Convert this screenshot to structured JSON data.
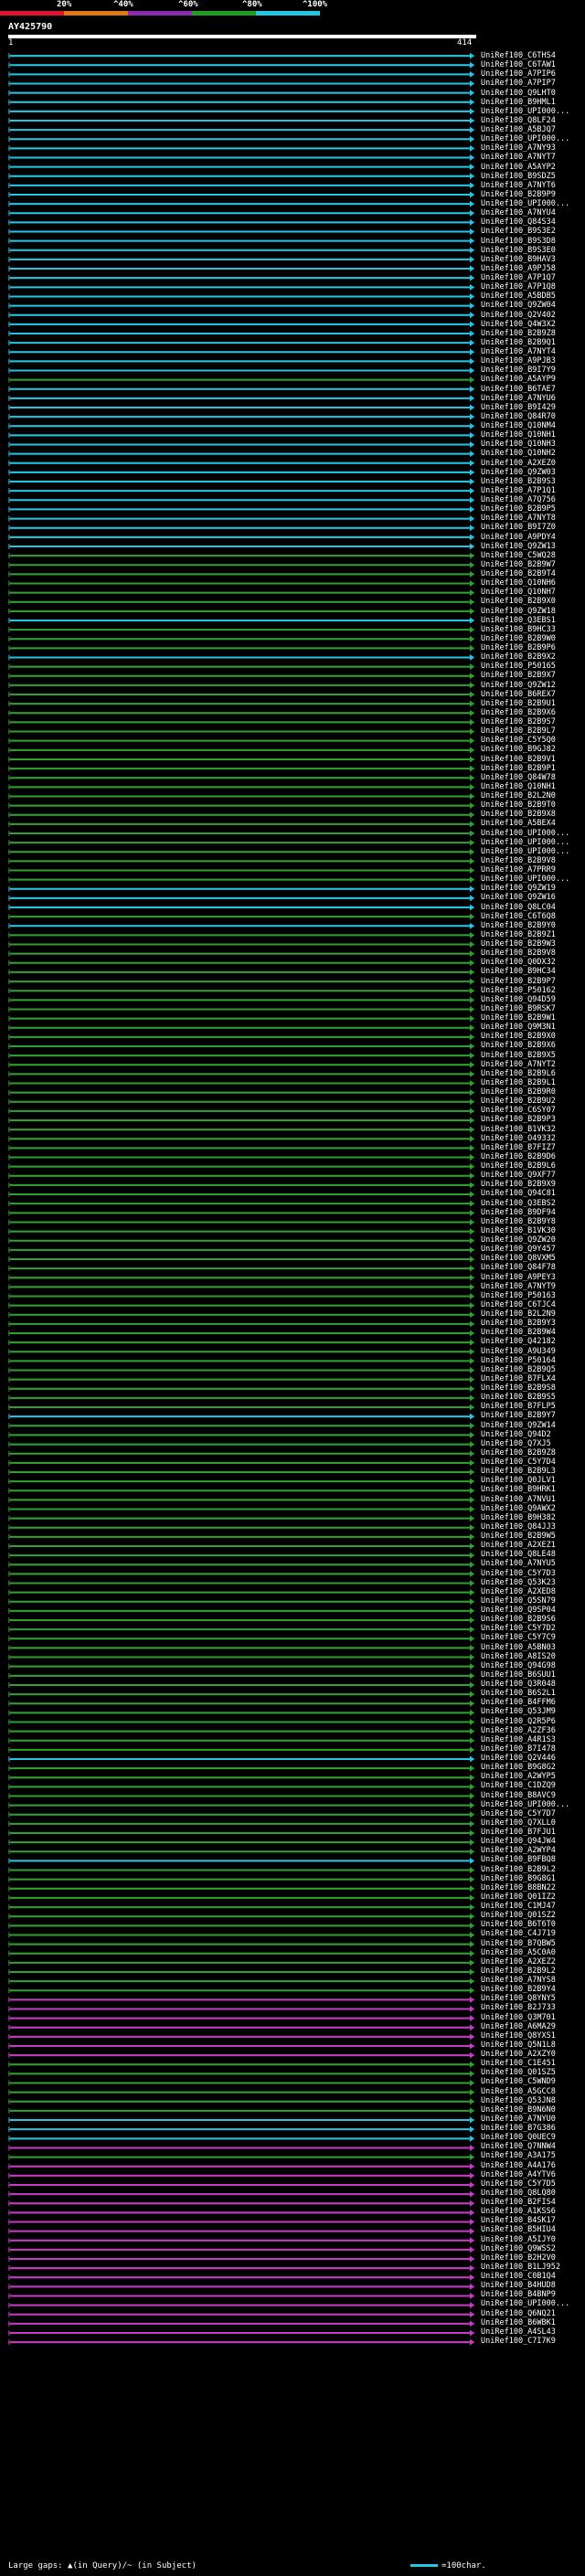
{
  "header": {
    "scale_ticks": [
      "20%",
      "^40%",
      "^60%",
      "^80%",
      "^100%"
    ],
    "scale_colors": [
      "#e0142c",
      "#e07a10",
      "#8a2bb0",
      "#1e9d1e",
      "#22c7e6"
    ],
    "query_name": "AY425790",
    "query_start": "1",
    "query_end": "414"
  },
  "footer": {
    "gap_note": "Large gaps: ▲(in Query)/~ (in Subject)",
    "scale_note": "=100char."
  },
  "colors": {
    "cyan": "#22c7e6",
    "green": "#2fa12f",
    "magenta": "#c93ac9",
    "gap": "#333333"
  },
  "hits": [
    {
      "id": "UniRef100_C6THS4",
      "color": "cyan"
    },
    {
      "id": "UniRef100_C6TAW1",
      "color": "cyan"
    },
    {
      "id": "UniRef100_A7PIP6",
      "color": "cyan"
    },
    {
      "id": "UniRef100_A7PIP7",
      "color": "cyan"
    },
    {
      "id": "UniRef100_Q9LHT0",
      "color": "cyan"
    },
    {
      "id": "UniRef100_B9HML1",
      "color": "cyan"
    },
    {
      "id": "UniRef100_UPI000...",
      "color": "cyan"
    },
    {
      "id": "UniRef100_Q8LF24",
      "color": "cyan"
    },
    {
      "id": "UniRef100_A5BJQ7",
      "color": "cyan"
    },
    {
      "id": "UniRef100_UPI000...",
      "color": "cyan"
    },
    {
      "id": "UniRef100_A7NY93",
      "color": "cyan"
    },
    {
      "id": "UniRef100_A7NYT7",
      "color": "cyan"
    },
    {
      "id": "UniRef100_A5AYP2",
      "color": "cyan"
    },
    {
      "id": "UniRef100_B9SDZ5",
      "color": "cyan"
    },
    {
      "id": "UniRef100_A7NYT6",
      "color": "cyan"
    },
    {
      "id": "UniRef100_B2B9P9",
      "color": "cyan"
    },
    {
      "id": "UniRef100_UPI000...",
      "color": "cyan"
    },
    {
      "id": "UniRef100_A7NYU4",
      "color": "cyan"
    },
    {
      "id": "UniRef100_Q84S34",
      "color": "cyan"
    },
    {
      "id": "UniRef100_B9S3E2",
      "color": "cyan"
    },
    {
      "id": "UniRef100_B9S3D8",
      "color": "cyan"
    },
    {
      "id": "UniRef100_B9S3E0",
      "color": "cyan"
    },
    {
      "id": "UniRef100_B9HAV3",
      "color": "cyan"
    },
    {
      "id": "UniRef100_A9PJ58",
      "color": "cyan"
    },
    {
      "id": "UniRef100_A7P1Q7",
      "color": "cyan"
    },
    {
      "id": "UniRef100_A7P1Q8",
      "color": "cyan"
    },
    {
      "id": "UniRef100_A5BDB5",
      "color": "cyan"
    },
    {
      "id": "UniRef100_Q9ZW04",
      "color": "cyan"
    },
    {
      "id": "UniRef100_Q2V402",
      "color": "cyan"
    },
    {
      "id": "UniRef100_Q4W3X2",
      "color": "cyan"
    },
    {
      "id": "UniRef100_B2B9Z8",
      "color": "cyan"
    },
    {
      "id": "UniRef100_B2B9Q1",
      "color": "cyan"
    },
    {
      "id": "UniRef100_A7NYT4",
      "color": "cyan"
    },
    {
      "id": "UniRef100_A9PJB3",
      "color": "cyan"
    },
    {
      "id": "UniRef100_B9I7Y9",
      "color": "cyan"
    },
    {
      "id": "UniRef100_A5AYP9",
      "color": "green"
    },
    {
      "id": "UniRef100_B6TAE7",
      "color": "cyan"
    },
    {
      "id": "UniRef100_A7NYU6",
      "color": "cyan"
    },
    {
      "id": "UniRef100_B9I429",
      "color": "cyan"
    },
    {
      "id": "UniRef100_Q84R70",
      "color": "cyan"
    },
    {
      "id": "UniRef100_Q10NM4",
      "color": "cyan"
    },
    {
      "id": "UniRef100_Q10NH1",
      "color": "cyan"
    },
    {
      "id": "UniRef100_Q10NH3",
      "color": "cyan"
    },
    {
      "id": "UniRef100_Q10NH2",
      "color": "cyan"
    },
    {
      "id": "UniRef100_A2XEZ0",
      "color": "cyan"
    },
    {
      "id": "UniRef100_Q9ZW03",
      "color": "cyan"
    },
    {
      "id": "UniRef100_B2B9S3",
      "color": "cyan"
    },
    {
      "id": "UniRef100_A7P1Q1",
      "color": "cyan"
    },
    {
      "id": "UniRef100_A7Q756",
      "color": "cyan"
    },
    {
      "id": "UniRef100_B2B9P5",
      "color": "cyan"
    },
    {
      "id": "UniRef100_A7NYT8",
      "color": "cyan"
    },
    {
      "id": "UniRef100_B9I7Z0",
      "color": "cyan"
    },
    {
      "id": "UniRef100_A9PDY4",
      "color": "cyan"
    },
    {
      "id": "UniRef100_Q9ZW13",
      "color": "cyan"
    },
    {
      "id": "UniRef100_C5WQ28",
      "color": "green"
    },
    {
      "id": "UniRef100_B2B9W7",
      "color": "green"
    },
    {
      "id": "UniRef100_B2B9T4",
      "color": "green"
    },
    {
      "id": "UniRef100_Q10NH6",
      "color": "green"
    },
    {
      "id": "UniRef100_Q10NH7",
      "color": "green"
    },
    {
      "id": "UniRef100_B2B9X0",
      "color": "green"
    },
    {
      "id": "UniRef100_Q9ZW18",
      "color": "green"
    },
    {
      "id": "UniRef100_Q3EBS1",
      "color": "cyan"
    },
    {
      "id": "UniRef100_B9HC33",
      "color": "green"
    },
    {
      "id": "UniRef100_B2B9W0",
      "color": "green"
    },
    {
      "id": "UniRef100_B2B9P6",
      "color": "green"
    },
    {
      "id": "UniRef100_B2B9X2",
      "color": "cyan"
    },
    {
      "id": "UniRef100_P50165",
      "color": "green"
    },
    {
      "id": "UniRef100_B2B9X7",
      "color": "green"
    },
    {
      "id": "UniRef100_Q9ZW12",
      "color": "green"
    },
    {
      "id": "UniRef100_B6REX7",
      "color": "green"
    },
    {
      "id": "UniRef100_B2B9U1",
      "color": "green"
    },
    {
      "id": "UniRef100_B2B9X6",
      "color": "green"
    },
    {
      "id": "UniRef100_B2B9S7",
      "color": "green"
    },
    {
      "id": "UniRef100_B2B9L7",
      "color": "green"
    },
    {
      "id": "UniRef100_C5Y5Q0",
      "color": "green"
    },
    {
      "id": "UniRef100_B9GJ82",
      "color": "green"
    },
    {
      "id": "UniRef100_B2B9V1",
      "color": "green"
    },
    {
      "id": "UniRef100_B2B9P1",
      "color": "green"
    },
    {
      "id": "UniRef100_Q84W78",
      "color": "green"
    },
    {
      "id": "UniRef100_Q10NH1",
      "color": "green"
    },
    {
      "id": "UniRef100_B2L2N0",
      "color": "green"
    },
    {
      "id": "UniRef100_B2B9T0",
      "color": "green"
    },
    {
      "id": "UniRef100_B2B9X8",
      "color": "green"
    },
    {
      "id": "UniRef100_A5BEX4",
      "color": "green"
    },
    {
      "id": "UniRef100_UPI000...",
      "color": "green"
    },
    {
      "id": "UniRef100_UPI000...",
      "color": "green"
    },
    {
      "id": "UniRef100_UPI000...",
      "color": "green"
    },
    {
      "id": "UniRef100_B2B9V8",
      "color": "green"
    },
    {
      "id": "UniRef100_A7PRR9",
      "color": "green"
    },
    {
      "id": "UniRef100_UPI000...",
      "color": "green"
    },
    {
      "id": "UniRef100_Q9ZW19",
      "color": "cyan"
    },
    {
      "id": "UniRef100_Q9ZW16",
      "color": "cyan"
    },
    {
      "id": "UniRef100_Q8LC04",
      "color": "cyan"
    },
    {
      "id": "UniRef100_C6T6Q8",
      "color": "green"
    },
    {
      "id": "UniRef100_B2B9Y0",
      "color": "cyan"
    },
    {
      "id": "UniRef100_B2B9Z1",
      "color": "green"
    },
    {
      "id": "UniRef100_B2B9W3",
      "color": "green"
    },
    {
      "id": "UniRef100_B2B9V8",
      "color": "green"
    },
    {
      "id": "UniRef100_Q0DX32",
      "color": "green"
    },
    {
      "id": "UniRef100_B9HC34",
      "color": "green"
    },
    {
      "id": "UniRef100_B2B9P7",
      "color": "green"
    },
    {
      "id": "UniRef100_P50162",
      "color": "green"
    },
    {
      "id": "UniRef100_Q94D59",
      "color": "green"
    },
    {
      "id": "UniRef100_B9RSK7",
      "color": "green"
    },
    {
      "id": "UniRef100_B2B9W1",
      "color": "green"
    },
    {
      "id": "UniRef100_Q9M3N1",
      "color": "green"
    },
    {
      "id": "UniRef100_B2B9X0",
      "color": "green"
    },
    {
      "id": "UniRef100_B2B9X6",
      "color": "green"
    },
    {
      "id": "UniRef100_B2B9X5",
      "color": "green"
    },
    {
      "id": "UniRef100_A7NYT2",
      "color": "green"
    },
    {
      "id": "UniRef100_B2B9L6",
      "color": "green"
    },
    {
      "id": "UniRef100_B2B9L1",
      "color": "green"
    },
    {
      "id": "UniRef100_B2B9R0",
      "color": "green"
    },
    {
      "id": "UniRef100_B2B9U2",
      "color": "green"
    },
    {
      "id": "UniRef100_C6SY07",
      "color": "green"
    },
    {
      "id": "UniRef100_B2B9P3",
      "color": "green"
    },
    {
      "id": "UniRef100_B1VK32",
      "color": "green"
    },
    {
      "id": "UniRef100_O49332",
      "color": "green"
    },
    {
      "id": "UniRef100_B7FIZ7",
      "color": "green"
    },
    {
      "id": "UniRef100_B2B9D6",
      "color": "green"
    },
    {
      "id": "UniRef100_B2B9L6",
      "color": "green"
    },
    {
      "id": "UniRef100_Q9XF77",
      "color": "green"
    },
    {
      "id": "UniRef100_B2B9X9",
      "color": "green"
    },
    {
      "id": "UniRef100_Q94C81",
      "color": "green"
    },
    {
      "id": "UniRef100_Q3EBS2",
      "color": "green"
    },
    {
      "id": "UniRef100_B9DF94",
      "color": "green"
    },
    {
      "id": "UniRef100_B2B9Y8",
      "color": "green"
    },
    {
      "id": "UniRef100_B1VK30",
      "color": "green"
    },
    {
      "id": "UniRef100_Q9ZW20",
      "color": "green"
    },
    {
      "id": "UniRef100_Q9Y457",
      "color": "green"
    },
    {
      "id": "UniRef100_Q8VXM5",
      "color": "green"
    },
    {
      "id": "UniRef100_Q84F78",
      "color": "green"
    },
    {
      "id": "UniRef100_A9PEY3",
      "color": "green"
    },
    {
      "id": "UniRef100_A7NYT9",
      "color": "green"
    },
    {
      "id": "UniRef100_P50163",
      "color": "green"
    },
    {
      "id": "UniRef100_C6TJC4",
      "color": "green"
    },
    {
      "id": "UniRef100_B2L2N9",
      "color": "green"
    },
    {
      "id": "UniRef100_B2B9Y3",
      "color": "green"
    },
    {
      "id": "UniRef100_B2B9W4",
      "color": "green"
    },
    {
      "id": "UniRef100_Q42182",
      "color": "green"
    },
    {
      "id": "UniRef100_A9U349",
      "color": "green"
    },
    {
      "id": "UniRef100_P50164",
      "color": "green"
    },
    {
      "id": "UniRef100_B2B9Q5",
      "color": "green"
    },
    {
      "id": "UniRef100_B7FLX4",
      "color": "green"
    },
    {
      "id": "UniRef100_B2B9S8",
      "color": "green"
    },
    {
      "id": "UniRef100_B2B9S5",
      "color": "green"
    },
    {
      "id": "UniRef100_B7FLP5",
      "color": "green"
    },
    {
      "id": "UniRef100_B2B9Y7",
      "color": "cyan"
    },
    {
      "id": "UniRef100_Q9ZW14",
      "color": "green"
    },
    {
      "id": "UniRef100_Q94D2",
      "color": "green"
    },
    {
      "id": "UniRef100_Q7XJ5",
      "color": "green"
    },
    {
      "id": "UniRef100_B2B9Z8",
      "color": "green"
    },
    {
      "id": "UniRef100_C5Y7D4",
      "color": "green"
    },
    {
      "id": "UniRef100_B2B9L3",
      "color": "green"
    },
    {
      "id": "UniRef100_Q0JLV1",
      "color": "green"
    },
    {
      "id": "UniRef100_B9HRK1",
      "color": "green"
    },
    {
      "id": "UniRef100_A7NVU1",
      "color": "green"
    },
    {
      "id": "UniRef100_Q9AWX2",
      "color": "green"
    },
    {
      "id": "UniRef100_B9H382",
      "color": "green"
    },
    {
      "id": "UniRef100_Q84JJ3",
      "color": "green"
    },
    {
      "id": "UniRef100_B2B9W5",
      "color": "green"
    },
    {
      "id": "UniRef100_A2XEZ1",
      "color": "green"
    },
    {
      "id": "UniRef100_Q8LE48",
      "color": "green"
    },
    {
      "id": "UniRef100_A7NYU5",
      "color": "green"
    },
    {
      "id": "UniRef100_C5Y7D3",
      "color": "green"
    },
    {
      "id": "UniRef100_Q53K23",
      "color": "green"
    },
    {
      "id": "UniRef100_A2XED8",
      "color": "green"
    },
    {
      "id": "UniRef100_Q5SN79",
      "color": "green"
    },
    {
      "id": "UniRef100_Q9SP04",
      "color": "green"
    },
    {
      "id": "UniRef100_B2B9S6",
      "color": "green"
    },
    {
      "id": "UniRef100_C5Y7D2",
      "color": "green"
    },
    {
      "id": "UniRef100_C5Y7C9",
      "color": "green"
    },
    {
      "id": "UniRef100_A5BN03",
      "color": "green"
    },
    {
      "id": "UniRef100_A8IS20",
      "color": "green"
    },
    {
      "id": "UniRef100_Q94G98",
      "color": "green"
    },
    {
      "id": "UniRef100_B6SUU1",
      "color": "green"
    },
    {
      "id": "UniRef100_Q3R048",
      "color": "green"
    },
    {
      "id": "UniRef100_B6S2L1",
      "color": "green"
    },
    {
      "id": "UniRef100_B4FFM6",
      "color": "green"
    },
    {
      "id": "UniRef100_Q53JM9",
      "color": "green"
    },
    {
      "id": "UniRef100_Q2R5P6",
      "color": "green"
    },
    {
      "id": "UniRef100_A2ZF36",
      "color": "green"
    },
    {
      "id": "UniRef100_A4R1S3",
      "color": "green"
    },
    {
      "id": "UniRef100_B7I478",
      "color": "green"
    },
    {
      "id": "UniRef100_Q2V446",
      "color": "cyan"
    },
    {
      "id": "UniRef100_B9G8G2",
      "color": "green"
    },
    {
      "id": "UniRef100_A2WYP5",
      "color": "green"
    },
    {
      "id": "UniRef100_C1DZQ9",
      "color": "green"
    },
    {
      "id": "UniRef100_B8AVC9",
      "color": "green"
    },
    {
      "id": "UniRef100_UPI000...",
      "color": "green"
    },
    {
      "id": "UniRef100_C5Y7D7",
      "color": "green"
    },
    {
      "id": "UniRef100_Q7XLL0",
      "color": "green"
    },
    {
      "id": "UniRef100_B7FJU1",
      "color": "green"
    },
    {
      "id": "UniRef100_Q94JW4",
      "color": "green"
    },
    {
      "id": "UniRef100_A2WYP4",
      "color": "green"
    },
    {
      "id": "UniRef100_B9FBQ8",
      "color": "cyan"
    },
    {
      "id": "UniRef100_B2B9L2",
      "color": "green"
    },
    {
      "id": "UniRef100_B9G8G1",
      "color": "green"
    },
    {
      "id": "UniRef100_B8BN22",
      "color": "green"
    },
    {
      "id": "UniRef100_Q01IZ2",
      "color": "green"
    },
    {
      "id": "UniRef100_C1MJ47",
      "color": "green"
    },
    {
      "id": "UniRef100_Q01SZ2",
      "color": "green"
    },
    {
      "id": "UniRef100_B6T6T0",
      "color": "green"
    },
    {
      "id": "UniRef100_C4J719",
      "color": "green"
    },
    {
      "id": "UniRef100_B7QBW5",
      "color": "green"
    },
    {
      "id": "UniRef100_A5C0A0",
      "color": "green"
    },
    {
      "id": "UniRef100_A2XEZ2",
      "color": "green"
    },
    {
      "id": "UniRef100_B2B9L2",
      "color": "green"
    },
    {
      "id": "UniRef100_A7NYS8",
      "color": "green"
    },
    {
      "id": "UniRef100_B2B9Y4",
      "color": "green"
    },
    {
      "id": "UniRef100_Q8YNY5",
      "color": "magenta"
    },
    {
      "id": "UniRef100_B2J733",
      "color": "magenta"
    },
    {
      "id": "UniRef100_Q3M701",
      "color": "magenta"
    },
    {
      "id": "UniRef100_A6MA29",
      "color": "magenta"
    },
    {
      "id": "UniRef100_Q8YXS1",
      "color": "magenta"
    },
    {
      "id": "UniRef100_Q5N1L8",
      "color": "magenta"
    },
    {
      "id": "UniRef100_A2XZY0",
      "color": "magenta"
    },
    {
      "id": "UniRef100_C1E451",
      "color": "green"
    },
    {
      "id": "UniRef100_Q01SZ5",
      "color": "green"
    },
    {
      "id": "UniRef100_C5WND9",
      "color": "green"
    },
    {
      "id": "UniRef100_A5GCC8",
      "color": "green"
    },
    {
      "id": "UniRef100_Q53JN8",
      "color": "green"
    },
    {
      "id": "UniRef100_B9N6N0",
      "color": "green"
    },
    {
      "id": "UniRef100_A7NYU0",
      "color": "cyan"
    },
    {
      "id": "UniRef100_B7G386",
      "color": "cyan"
    },
    {
      "id": "UniRef100_Q0UEC9",
      "color": "cyan"
    },
    {
      "id": "UniRef100_Q7NNW4",
      "color": "magenta"
    },
    {
      "id": "UniRef100_A3A175",
      "color": "green"
    },
    {
      "id": "UniRef100_A4A176",
      "color": "magenta"
    },
    {
      "id": "UniRef100_A4YTV6",
      "color": "magenta"
    },
    {
      "id": "UniRef100_C5Y7D5",
      "color": "magenta"
    },
    {
      "id": "UniRef100_Q8LQ80",
      "color": "magenta"
    },
    {
      "id": "UniRef100_B2FIS4",
      "color": "magenta"
    },
    {
      "id": "UniRef100_A1KSS6",
      "color": "magenta"
    },
    {
      "id": "UniRef100_B4SK17",
      "color": "magenta"
    },
    {
      "id": "UniRef100_B5HIU4",
      "color": "magenta"
    },
    {
      "id": "UniRef100_A5IJY0",
      "color": "magenta"
    },
    {
      "id": "UniRef100_Q9WSS2",
      "color": "magenta"
    },
    {
      "id": "UniRef100_B2H2V0",
      "color": "magenta"
    },
    {
      "id": "UniRef100_B1LJ952",
      "color": "magenta"
    },
    {
      "id": "UniRef100_C0B1Q4",
      "color": "magenta"
    },
    {
      "id": "UniRef100_B4HUD8",
      "color": "magenta"
    },
    {
      "id": "UniRef100_B4BNP9",
      "color": "magenta"
    },
    {
      "id": "UniRef100_UPI000...",
      "color": "magenta"
    },
    {
      "id": "UniRef100_Q6NQ21",
      "color": "magenta"
    },
    {
      "id": "UniRef100_B6WBK1",
      "color": "magenta"
    },
    {
      "id": "UniRef100_A4SL43",
      "color": "magenta"
    },
    {
      "id": "UniRef100_C7I7K9",
      "color": "magenta"
    }
  ]
}
